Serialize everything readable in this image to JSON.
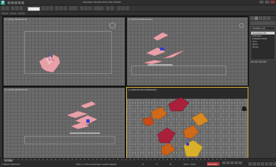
{
  "window": {
    "title": "Autodesk 3ds Max 2013 x64   Untitled",
    "logo_letter": "3"
  },
  "toolbar": {
    "selection_filter": "All"
  },
  "viewports": {
    "top_left": {
      "label": "[+] [Top] [Wireframe]"
    },
    "top_right": {
      "label": "[+] [Front] [Wireframe]"
    },
    "bottom_left": {
      "label": "[+] [Left] [Wireframe]"
    },
    "bottom_right": {
      "label": "[+] [Perspective] [Realistic]"
    }
  },
  "command_panel": {
    "header": "Modifier List",
    "rollout": "Modifier List",
    "list_items": [
      "TurboSmooth",
      "Edit Poly",
      "Editable Mesh",
      "Line",
      "Bend",
      "Noise"
    ],
    "selected_index": 0
  },
  "timeline": {
    "frame_display": "0 / 100"
  },
  "status": {
    "selection": "1 Object Selected",
    "prompt": "Click or click-and-drag to select objects",
    "x": "X:",
    "y": "Y:",
    "z": "Z:",
    "grid": "Grid = 10.0",
    "auto_key": "Auto Key"
  },
  "colors": {
    "leaf_pink": "#e8a0a8",
    "leaf_red": "#a8203a",
    "leaf_orange": "#d06a18",
    "leaf_yellow": "#d8b02a",
    "active_border": "#e8c040"
  }
}
